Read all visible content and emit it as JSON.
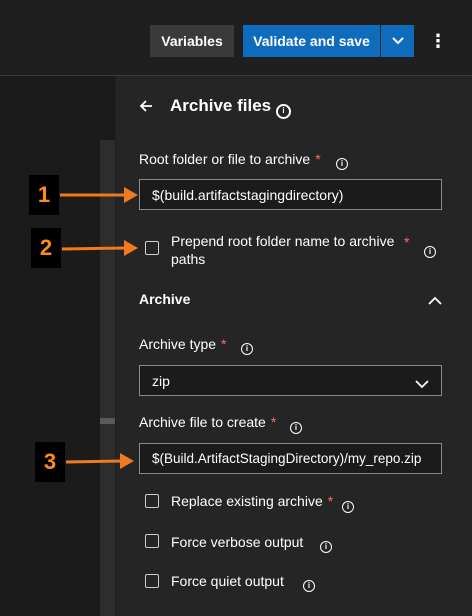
{
  "toolbar": {
    "variables_label": "Variables",
    "validate_label": "Validate and save",
    "more_label": "⋮"
  },
  "panel": {
    "title": "Archive files",
    "root_folder": {
      "label": "Root folder or file to archive",
      "required": "*",
      "value": "$(build.artifactstagingdirectory)"
    },
    "prepend": {
      "label": "Prepend root folder name to archive paths",
      "required": "*",
      "checked": false
    },
    "archive_section": {
      "label": "Archive"
    },
    "archive_type": {
      "label": "Archive type",
      "required": "*",
      "value": "zip"
    },
    "archive_file": {
      "label": "Archive file to create",
      "required": "*",
      "value": "$(Build.ArtifactStagingDirectory)/my_repo.zip"
    },
    "replace_existing": {
      "label": "Replace existing archive",
      "required": "*",
      "checked": false
    },
    "force_verbose": {
      "label": "Force verbose output",
      "checked": false
    },
    "force_quiet": {
      "label": "Force quiet output",
      "checked": false
    }
  },
  "callouts": [
    "1",
    "2",
    "3"
  ],
  "colors": {
    "accent": "#0f6cbd",
    "required": "#ff6b6b",
    "callout_text": "#ff8c1a",
    "arrow": "#f07a1e"
  }
}
